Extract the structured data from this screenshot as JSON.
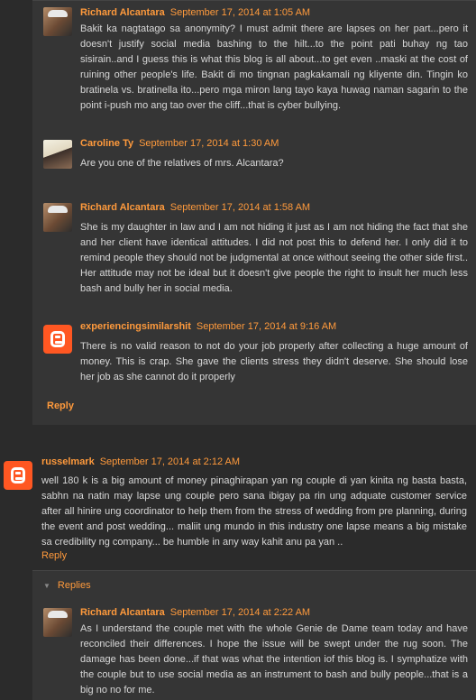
{
  "thread1": {
    "comments": [
      {
        "author": "Richard Alcantara",
        "date": "September 17, 2014 at 1:05 AM",
        "body": "Bakit ka nagtatago sa anonymity? I must admit there are lapses on her part...pero it doesn't justify social media bashing to the hilt...to the point pati buhay ng tao sisirain..and I guess this is what this blog is all about...to get even ..maski at the cost of ruining other people's life. Bakit di mo tingnan pagkakamali ng kliyente din. Tingin ko bratinela vs. bratinella ito...pero mga miron lang tayo kaya huwag naman sagarin to the point i-push mo ang tao over the cliff...that is cyber bullying."
      },
      {
        "author": "Caroline Ty",
        "date": "September 17, 2014 at 1:30 AM",
        "body": "Are you one of the relatives of mrs. Alcantara?"
      },
      {
        "author": "Richard Alcantara",
        "date": "September 17, 2014 at 1:58 AM",
        "body": "She is my daughter in law and I am not hiding it just as I am not hiding the fact that she and her client have identical attitudes. I did not post this to defend her. I only did it to remind people they should not be judgmental at once without seeing the other side first.. Her attitude may not be ideal but it doesn't give people the right to insult her much less bash and bully her in social media."
      },
      {
        "author": "experiencingsimilarshit",
        "date": "September 17, 2014 at 9:16 AM",
        "body": "There is no valid reason to not do your job properly after collecting a huge amount of money. This is crap. She gave the clients stress they didn't deserve. She should lose her job as she cannot do it properly"
      }
    ],
    "reply_label": "Reply"
  },
  "toplevel": {
    "author": "russelmark",
    "date": "September 17, 2014 at 2:12 AM",
    "body": "well 180 k is a big amount of money pinaghirapan yan ng couple di yan kinita ng basta basta, sabhn na natin may lapse ung couple pero sana ibigay pa rin ung adquate customer service after all hinire ung coordinator to help them from the stress of wedding from pre planning, during the event and post wedding... maliit ung mundo in this industry one lapse means a big mistake sa credibility ng company... be humble in any way kahit anu pa yan ..",
    "reply_label": "Reply"
  },
  "thread2": {
    "replies_label": "Replies",
    "comments": [
      {
        "author": "Richard Alcantara",
        "date": "September 17, 2014 at 2:22 AM",
        "body": "As I understand the couple met with the whole Genie de Dame team today and have reconciled their differences. I hope the issue will be swept under the rug soon. The damage has been done...if that was what the intention iof this blog is. I symphatize with the couple but to use social media as an instrument to bash and bully people...that is a big no no for me."
      }
    ]
  }
}
